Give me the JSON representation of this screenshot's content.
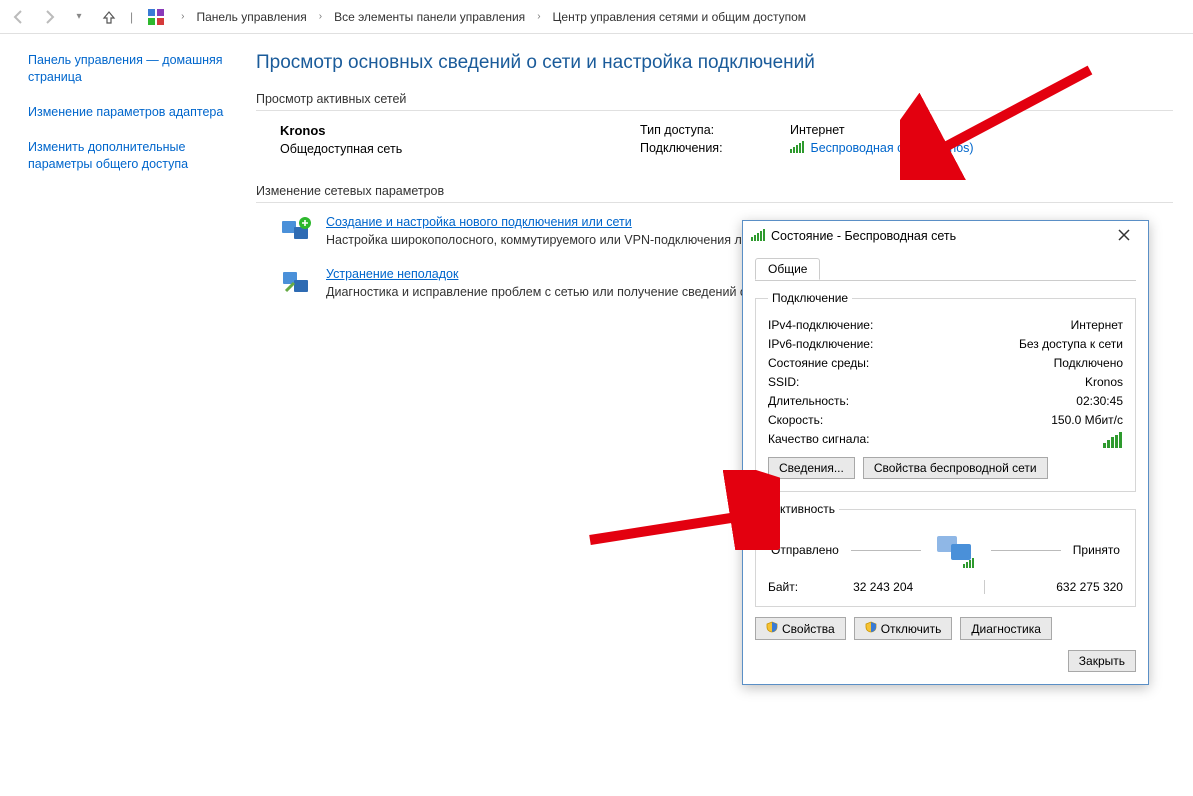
{
  "breadcrumb": {
    "root": "Панель управления",
    "mid": "Все элементы панели управления",
    "leaf": "Центр управления сетями и общим доступом"
  },
  "sidebar": {
    "home": "Панель управления — домашняя страница",
    "adapter": "Изменение параметров адаптера",
    "sharing": "Изменить дополнительные параметры общего доступа"
  },
  "page": {
    "title": "Просмотр основных сведений о сети и настройка подключений",
    "active_label": "Просмотр активных сетей",
    "change_label": "Изменение сетевых параметров"
  },
  "network": {
    "name": "Kronos",
    "profile": "Общедоступная сеть",
    "access_label": "Тип доступа:",
    "access_value": "Интернет",
    "conn_label": "Подключения:",
    "conn_link": "Беспроводная сеть (Kronos)"
  },
  "options": {
    "create_link": "Создание и настройка нового подключения или сети",
    "create_desc": "Настройка широкополосного, коммутируемого или VPN-подключения либо настройка маршрутизатора или точки доступа.",
    "diag_link": "Устранение неполадок",
    "diag_desc": "Диагностика и исправление проблем с сетью или получение сведений об устранении неполадок."
  },
  "dialog": {
    "title": "Состояние - Беспроводная сеть",
    "tab_general": "Общие",
    "group_connection": "Подключение",
    "ipv4_l": "IPv4-подключение:",
    "ipv4_v": "Интернет",
    "ipv6_l": "IPv6-подключение:",
    "ipv6_v": "Без доступа к сети",
    "state_l": "Состояние среды:",
    "state_v": "Подключено",
    "ssid_l": "SSID:",
    "ssid_v": "Kronos",
    "dur_l": "Длительность:",
    "dur_v": "02:30:45",
    "speed_l": "Скорость:",
    "speed_v": "150.0 Мбит/с",
    "signal_l": "Качество сигнала:",
    "btn_details": "Сведения...",
    "btn_wprops": "Свойства беспроводной сети",
    "group_activity": "Активность",
    "sent": "Отправлено",
    "recv": "Принято",
    "bytes_l": "Байт:",
    "bytes_sent": "32 243 204",
    "bytes_recv": "632 275 320",
    "btn_props": "Свойства",
    "btn_disable": "Отключить",
    "btn_diag": "Диагностика",
    "btn_close": "Закрыть"
  }
}
